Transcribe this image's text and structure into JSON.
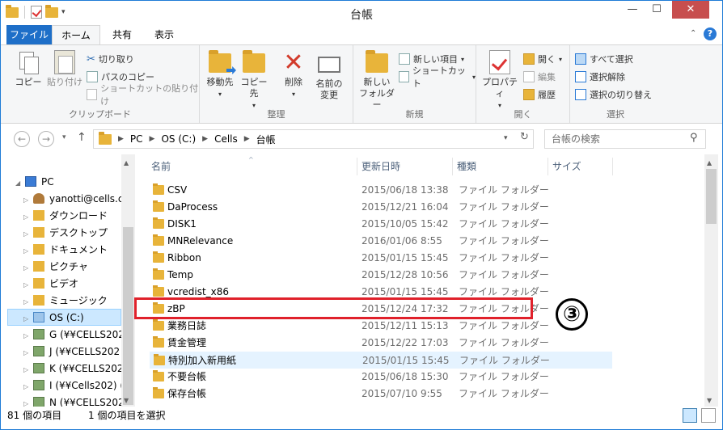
{
  "window": {
    "title": "台帳"
  },
  "controls": {
    "minimize": "—",
    "maximize": "☐",
    "close": "✕"
  },
  "tabs": {
    "file": "ファイル",
    "home": "ホーム",
    "share": "共有",
    "view": "表示"
  },
  "ribbon": {
    "clipboard": {
      "copy": "コピー",
      "paste": "貼り付け",
      "cut": "切り取り",
      "copy_path": "パスのコピー",
      "paste_shortcut": "ショートカットの貼り付け",
      "label": "クリップボード"
    },
    "organize": {
      "move_to": "移動先",
      "copy_to": "コピー先",
      "delete": "削除",
      "rename_line1": "名前の",
      "rename_line2": "変更",
      "label": "整理"
    },
    "new": {
      "new_folder_line1": "新しい",
      "new_folder_line2": "フォルダー",
      "new_item": "新しい項目",
      "easy_access": "ショートカット",
      "label": "新規"
    },
    "open": {
      "properties": "プロパティ",
      "open": "開く",
      "edit": "編集",
      "history": "履歴",
      "label": "開く"
    },
    "select": {
      "select_all": "すべて選択",
      "select_none": "選択解除",
      "invert": "選択の切り替え",
      "label": "選択"
    }
  },
  "address": {
    "crumbs": [
      "PC",
      "OS (C:)",
      "Cells",
      "台帳"
    ],
    "search_placeholder": "台帳の検索"
  },
  "navpane": {
    "items": [
      {
        "label": "PC",
        "icon": "pc-icon"
      },
      {
        "label": "yanotti@cells.c",
        "icon": "user-icon"
      },
      {
        "label": "ダウンロード",
        "icon": "downloads-icon"
      },
      {
        "label": "デスクトップ",
        "icon": "desktop-icon"
      },
      {
        "label": "ドキュメント",
        "icon": "documents-icon"
      },
      {
        "label": "ピクチャ",
        "icon": "pictures-icon"
      },
      {
        "label": "ビデオ",
        "icon": "videos-icon"
      },
      {
        "label": "ミュージック",
        "icon": "music-icon"
      },
      {
        "label": "OS (C:)",
        "icon": "drive-icon"
      },
      {
        "label": "G (¥¥CELLS202",
        "icon": "network-drive-icon"
      },
      {
        "label": "J (¥¥CELLS202",
        "icon": "network-drive-icon"
      },
      {
        "label": "K (¥¥CELLS202",
        "icon": "network-drive-icon"
      },
      {
        "label": "I (¥¥Cells202) (",
        "icon": "network-drive-icon"
      },
      {
        "label": "N (¥¥CELLS202",
        "icon": "network-drive-icon"
      }
    ]
  },
  "filelist": {
    "columns": {
      "name": "名前",
      "date": "更新日時",
      "type": "種類",
      "size": "サイズ"
    },
    "rows": [
      {
        "name": "CSV",
        "date": "2015/06/18 13:38",
        "type": "ファイル フォルダー"
      },
      {
        "name": "DaProcess",
        "date": "2015/12/21 16:04",
        "type": "ファイル フォルダー"
      },
      {
        "name": "DISK1",
        "date": "2015/10/05 15:42",
        "type": "ファイル フォルダー"
      },
      {
        "name": "MNRelevance",
        "date": "2016/01/06 8:55",
        "type": "ファイル フォルダー"
      },
      {
        "name": "Ribbon",
        "date": "2015/01/15 15:45",
        "type": "ファイル フォルダー"
      },
      {
        "name": "Temp",
        "date": "2015/12/28 10:56",
        "type": "ファイル フォルダー"
      },
      {
        "name": "vcredist_x86",
        "date": "2015/01/15 15:45",
        "type": "ファイル フォルダー"
      },
      {
        "name": "zBP",
        "date": "2015/12/24 17:32",
        "type": "ファイル フォルダー"
      },
      {
        "name": "業務日誌",
        "date": "2015/12/11 15:13",
        "type": "ファイル フォルダー"
      },
      {
        "name": "賃金管理",
        "date": "2015/12/22 17:03",
        "type": "ファイル フォルダー"
      },
      {
        "name": "特別加入新用紙",
        "date": "2015/01/15 15:45",
        "type": "ファイル フォルダー"
      },
      {
        "name": "不要台帳",
        "date": "2015/06/18 15:30",
        "type": "ファイル フォルダー"
      },
      {
        "name": "保存台帳",
        "date": "2015/07/10 9:55",
        "type": "ファイル フォルダー"
      }
    ]
  },
  "annotation": {
    "marker": "③",
    "color": "#e0212b"
  },
  "status": {
    "count": "81 個の項目",
    "selected": "1 個の項目を選択"
  }
}
